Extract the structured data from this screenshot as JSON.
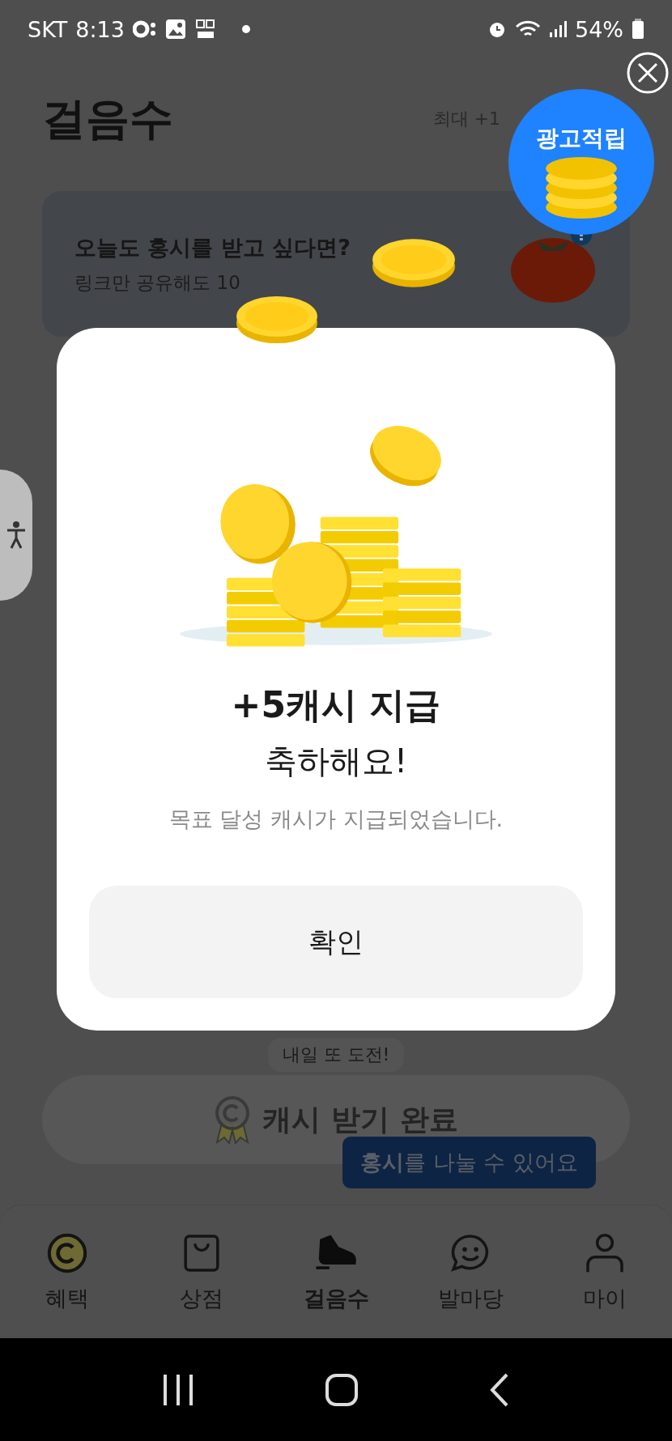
{
  "status_bar": {
    "carrier": "SKT",
    "time": "8:13",
    "battery": "54%"
  },
  "header": {
    "title": "걸음수",
    "note": "최대 +1"
  },
  "ad_bubble": {
    "label": "광고적립"
  },
  "banner": {
    "title": "오늘도 홍시를 받고 싶다면?",
    "subtitle": "링크만 공유해도 10"
  },
  "modal": {
    "amount": "+5캐시 지급",
    "title": "축하해요!",
    "message": "목표 달성 캐시가 지급되었습니다.",
    "button": "확인"
  },
  "cash_button": {
    "label": "캐시 받기 완료",
    "tooltip": "내일 또 도전!"
  },
  "share_tooltip": "**홍시**를 나눌 수 있어요",
  "tabs": [
    {
      "label": "혜택",
      "kind": "coin",
      "selected": false
    },
    {
      "label": "상점",
      "kind": "bag",
      "selected": false
    },
    {
      "label": "걸음수",
      "kind": "shoe",
      "selected": true
    },
    {
      "label": "발마당",
      "kind": "chat",
      "selected": false
    },
    {
      "label": "마이",
      "kind": "person",
      "selected": false
    }
  ]
}
